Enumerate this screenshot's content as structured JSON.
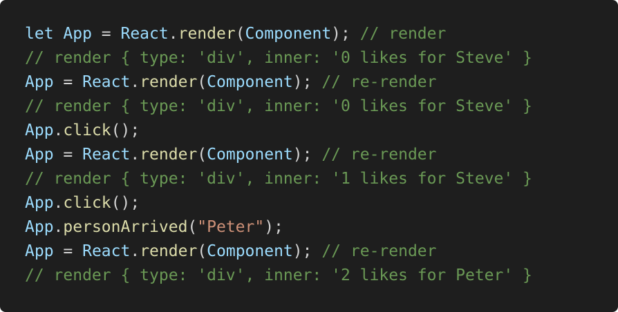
{
  "code": {
    "lines": [
      {
        "tokens": [
          {
            "text": "let ",
            "kind": "keyword"
          },
          {
            "text": "App",
            "kind": "var"
          },
          {
            "text": " = ",
            "kind": "punct"
          },
          {
            "text": "React",
            "kind": "var"
          },
          {
            "text": ".",
            "kind": "punct"
          },
          {
            "text": "render",
            "kind": "func"
          },
          {
            "text": "(",
            "kind": "punct"
          },
          {
            "text": "Component",
            "kind": "var"
          },
          {
            "text": "); ",
            "kind": "punct"
          },
          {
            "text": "// render",
            "kind": "comment"
          }
        ]
      },
      {
        "tokens": [
          {
            "text": "// render { type: 'div', inner: '0 likes for Steve' }",
            "kind": "comment"
          }
        ]
      },
      {
        "tokens": [
          {
            "text": "App",
            "kind": "var"
          },
          {
            "text": " = ",
            "kind": "punct"
          },
          {
            "text": "React",
            "kind": "var"
          },
          {
            "text": ".",
            "kind": "punct"
          },
          {
            "text": "render",
            "kind": "func"
          },
          {
            "text": "(",
            "kind": "punct"
          },
          {
            "text": "Component",
            "kind": "var"
          },
          {
            "text": "); ",
            "kind": "punct"
          },
          {
            "text": "// re-render",
            "kind": "comment"
          }
        ]
      },
      {
        "tokens": [
          {
            "text": "// render { type: 'div', inner: '0 likes for Steve' }",
            "kind": "comment"
          }
        ]
      },
      {
        "tokens": [
          {
            "text": "App",
            "kind": "var"
          },
          {
            "text": ".",
            "kind": "punct"
          },
          {
            "text": "click",
            "kind": "func"
          },
          {
            "text": "();",
            "kind": "punct"
          }
        ]
      },
      {
        "tokens": [
          {
            "text": "App",
            "kind": "var"
          },
          {
            "text": " = ",
            "kind": "punct"
          },
          {
            "text": "React",
            "kind": "var"
          },
          {
            "text": ".",
            "kind": "punct"
          },
          {
            "text": "render",
            "kind": "func"
          },
          {
            "text": "(",
            "kind": "punct"
          },
          {
            "text": "Component",
            "kind": "var"
          },
          {
            "text": "); ",
            "kind": "punct"
          },
          {
            "text": "// re-render",
            "kind": "comment"
          }
        ]
      },
      {
        "tokens": [
          {
            "text": "// render { type: 'div', inner: '1 likes for Steve' }",
            "kind": "comment"
          }
        ]
      },
      {
        "tokens": [
          {
            "text": "App",
            "kind": "var"
          },
          {
            "text": ".",
            "kind": "punct"
          },
          {
            "text": "click",
            "kind": "func"
          },
          {
            "text": "();",
            "kind": "punct"
          }
        ]
      },
      {
        "tokens": [
          {
            "text": "App",
            "kind": "var"
          },
          {
            "text": ".",
            "kind": "punct"
          },
          {
            "text": "personArrived",
            "kind": "func"
          },
          {
            "text": "(",
            "kind": "punct"
          },
          {
            "text": "\"Peter\"",
            "kind": "string"
          },
          {
            "text": ");",
            "kind": "punct"
          }
        ]
      },
      {
        "tokens": [
          {
            "text": "App",
            "kind": "var"
          },
          {
            "text": " = ",
            "kind": "punct"
          },
          {
            "text": "React",
            "kind": "var"
          },
          {
            "text": ".",
            "kind": "punct"
          },
          {
            "text": "render",
            "kind": "func"
          },
          {
            "text": "(",
            "kind": "punct"
          },
          {
            "text": "Component",
            "kind": "var"
          },
          {
            "text": "); ",
            "kind": "punct"
          },
          {
            "text": "// re-render",
            "kind": "comment"
          }
        ]
      },
      {
        "tokens": [
          {
            "text": "// render { type: 'div', inner: '2 likes for Peter' }",
            "kind": "comment"
          }
        ]
      }
    ]
  },
  "colors": {
    "background": "#1e1e1e",
    "keyword": "#9cdcfe",
    "variable": "#9cdcfe",
    "function": "#dcdcaa",
    "punctuation": "#d4d4d4",
    "string": "#ce9178",
    "comment": "#6a9955"
  }
}
